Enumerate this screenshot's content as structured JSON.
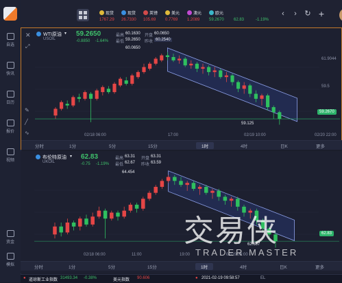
{
  "sidebar": {
    "items": [
      {
        "label": "自选",
        "icon": "watchlist-icon"
      },
      {
        "label": "快讯",
        "icon": "news-icon"
      },
      {
        "label": "日历",
        "icon": "calendar-icon"
      },
      {
        "label": "报价",
        "icon": "quote-icon"
      },
      {
        "label": "视频",
        "icon": "video-icon"
      },
      {
        "label": "资金",
        "icon": "funds-icon"
      },
      {
        "label": "模拟",
        "icon": "simulation-icon"
      }
    ]
  },
  "tickers": [
    {
      "name": "现货",
      "value": "1767.29",
      "color": "#e0b93a"
    },
    {
      "name": "现货",
      "value": "26.7330",
      "color": "#3a8fe0"
    },
    {
      "name": "英镑",
      "value": "105.69",
      "color": "#d24a4a"
    },
    {
      "name": "美元",
      "value": "0.7769",
      "color": "#e0b93a"
    },
    {
      "name": "澳元",
      "value": "1.2089",
      "color": "#c24ad2"
    },
    {
      "name": "欧元",
      "value": "59.2670",
      "color": "#3ab7c9"
    },
    {
      "name": "",
      "value": "62.83",
      "color": "#3fc16b"
    },
    {
      "name": "",
      "value": "-1.19%",
      "color": "#3fc16b"
    }
  ],
  "wti": {
    "title": "WTI原油",
    "code": "USOIL",
    "price": "59.2650",
    "change": "-0.8850",
    "change_pct": "-1.64%",
    "high_label": "最高",
    "high": "60.1630",
    "open_label": "开盘",
    "open": "60.0650",
    "low_label": "最低",
    "low": "59.2650",
    "prev_label": "昨收",
    "prev": "60.2540",
    "axis_top": "60.0650",
    "axis_right": [
      "61.9044",
      "59.5"
    ],
    "last_tag": "59.2670",
    "low_mark": "59.125",
    "x_labels": [
      "02/18 06:00",
      "17:00",
      "02/19 10:00",
      "02/20 22:00"
    ],
    "candles": [
      [
        59.4,
        59.6,
        59.3,
        59.65
      ],
      [
        59.6,
        59.8,
        59.55,
        59.85
      ],
      [
        59.75,
        59.7,
        59.6,
        59.85
      ],
      [
        59.7,
        59.95,
        59.65,
        60.0
      ],
      [
        59.95,
        59.9,
        59.8,
        60.05
      ],
      [
        59.9,
        60.1,
        59.85,
        60.15
      ],
      [
        60.05,
        59.9,
        59.2,
        60.1
      ],
      [
        59.9,
        60.15,
        59.85,
        60.2
      ],
      [
        60.1,
        60.25,
        60.0,
        60.3
      ],
      [
        60.2,
        60.1,
        60.05,
        60.28
      ],
      [
        60.1,
        60.35,
        60.05,
        60.4
      ],
      [
        60.3,
        60.5,
        60.25,
        60.55
      ],
      [
        60.45,
        60.35,
        60.3,
        60.55
      ],
      [
        60.35,
        60.6,
        60.3,
        60.65
      ],
      [
        60.55,
        60.7,
        60.5,
        60.75
      ],
      [
        60.7,
        60.85,
        60.65,
        60.95
      ],
      [
        60.8,
        60.95,
        60.75,
        61.0
      ],
      [
        60.95,
        61.1,
        60.9,
        61.15
      ],
      [
        61.05,
        61.2,
        61.0,
        61.25
      ],
      [
        61.2,
        61.15,
        61.05,
        61.3
      ],
      [
        61.15,
        61.05,
        61.0,
        61.25
      ],
      [
        61.05,
        61.1,
        60.95,
        61.2
      ],
      [
        61.1,
        60.9,
        60.85,
        61.15
      ],
      [
        60.9,
        60.95,
        60.8,
        61.05
      ],
      [
        60.95,
        60.8,
        60.7,
        61.0
      ],
      [
        60.8,
        60.85,
        60.65,
        60.95
      ],
      [
        60.85,
        60.7,
        60.6,
        60.9
      ],
      [
        60.7,
        60.75,
        60.55,
        60.85
      ],
      [
        60.75,
        60.55,
        60.5,
        60.8
      ],
      [
        60.55,
        60.6,
        60.4,
        60.7
      ],
      [
        60.6,
        60.4,
        60.3,
        60.65
      ],
      [
        60.4,
        60.2,
        60.1,
        60.45
      ],
      [
        60.2,
        60.3,
        60.05,
        60.4
      ],
      [
        60.3,
        60.05,
        59.95,
        60.35
      ],
      [
        60.05,
        59.9,
        59.8,
        60.15
      ],
      [
        59.9,
        60.0,
        59.7,
        60.05
      ],
      [
        60.0,
        59.65,
        59.55,
        60.05
      ],
      [
        59.65,
        59.5,
        59.3,
        59.7
      ],
      [
        59.5,
        59.3,
        59.125,
        59.55
      ]
    ]
  },
  "timeframes": [
    "分时",
    "1分",
    "5分",
    "15分",
    "1时",
    "4时",
    "日K",
    "更多"
  ],
  "timeframes2": [
    "分时",
    "1分",
    "5分",
    "15分",
    "1时",
    "4时",
    "日K",
    "更多"
  ],
  "brent": {
    "title": "布伦特原油",
    "code": "UKOIL",
    "price": "62.83",
    "change": "-0.75",
    "change_pct": "-1.19%",
    "high_label": "最高",
    "high": "63.31",
    "open_label": "开盘",
    "open": "63.31",
    "low_label": "最低",
    "low": "62.67",
    "prev_label": "昨收",
    "prev": "63.59",
    "axis_top": "64.454",
    "last_tag": "62.83",
    "low_mark": "62.667",
    "x_labels": [
      "02/18 06:00",
      "11:00",
      "19:00",
      "02/19 03:00"
    ],
    "candles": [
      [
        63.0,
        63.2,
        62.9,
        63.3
      ],
      [
        63.2,
        63.05,
        62.95,
        63.3
      ],
      [
        63.05,
        63.3,
        63.0,
        63.4
      ],
      [
        63.3,
        63.2,
        63.1,
        63.35
      ],
      [
        63.2,
        63.4,
        63.1,
        63.45
      ],
      [
        63.4,
        63.25,
        63.2,
        63.5
      ],
      [
        63.25,
        63.45,
        63.2,
        63.55
      ],
      [
        63.45,
        63.6,
        63.4,
        63.7
      ],
      [
        63.6,
        63.4,
        62.9,
        63.65
      ],
      [
        63.4,
        63.55,
        63.35,
        63.6
      ],
      [
        63.55,
        63.45,
        63.35,
        63.6
      ],
      [
        63.45,
        63.6,
        63.4,
        63.7
      ],
      [
        63.6,
        63.75,
        63.55,
        63.8
      ],
      [
        63.75,
        63.65,
        63.55,
        63.8
      ],
      [
        63.65,
        63.9,
        63.6,
        63.95
      ],
      [
        63.9,
        64.05,
        63.85,
        64.1
      ],
      [
        64.05,
        64.2,
        64.0,
        64.25
      ],
      [
        64.2,
        64.35,
        64.15,
        64.4
      ],
      [
        64.35,
        64.45,
        64.3,
        64.5
      ],
      [
        64.45,
        64.35,
        64.25,
        64.5
      ],
      [
        64.35,
        64.25,
        64.2,
        64.45
      ],
      [
        64.25,
        64.3,
        64.1,
        64.35
      ],
      [
        64.3,
        64.15,
        64.1,
        64.35
      ],
      [
        64.15,
        64.2,
        64.0,
        64.25
      ],
      [
        64.2,
        64.05,
        64.0,
        64.25
      ],
      [
        64.05,
        64.1,
        63.9,
        64.15
      ],
      [
        64.1,
        63.95,
        63.85,
        64.15
      ],
      [
        63.95,
        63.85,
        63.75,
        64.0
      ],
      [
        63.85,
        63.9,
        63.7,
        63.95
      ],
      [
        63.9,
        63.7,
        63.6,
        63.95
      ],
      [
        63.7,
        63.55,
        63.45,
        63.75
      ],
      [
        63.55,
        63.6,
        63.4,
        63.65
      ],
      [
        63.6,
        63.35,
        63.25,
        63.65
      ],
      [
        63.35,
        63.15,
        63.05,
        63.4
      ],
      [
        63.15,
        63.0,
        62.9,
        63.2
      ],
      [
        63.0,
        62.83,
        62.667,
        63.05
      ]
    ]
  },
  "status": {
    "item1_name": "道琼斯工业指数",
    "item1_value": "31493.34",
    "item1_pct": "-0.38%",
    "item2_name": "美元指数",
    "item2_value": "90.606",
    "item3_name": "2021-02-19 09:58:57",
    "item4": "EL"
  },
  "watermark": {
    "main": "交易侠",
    "sub": "TRADER MASTER"
  },
  "colors": {
    "up": "#e54646",
    "down": "#2fbf5f",
    "channel": "#2a3a78"
  }
}
